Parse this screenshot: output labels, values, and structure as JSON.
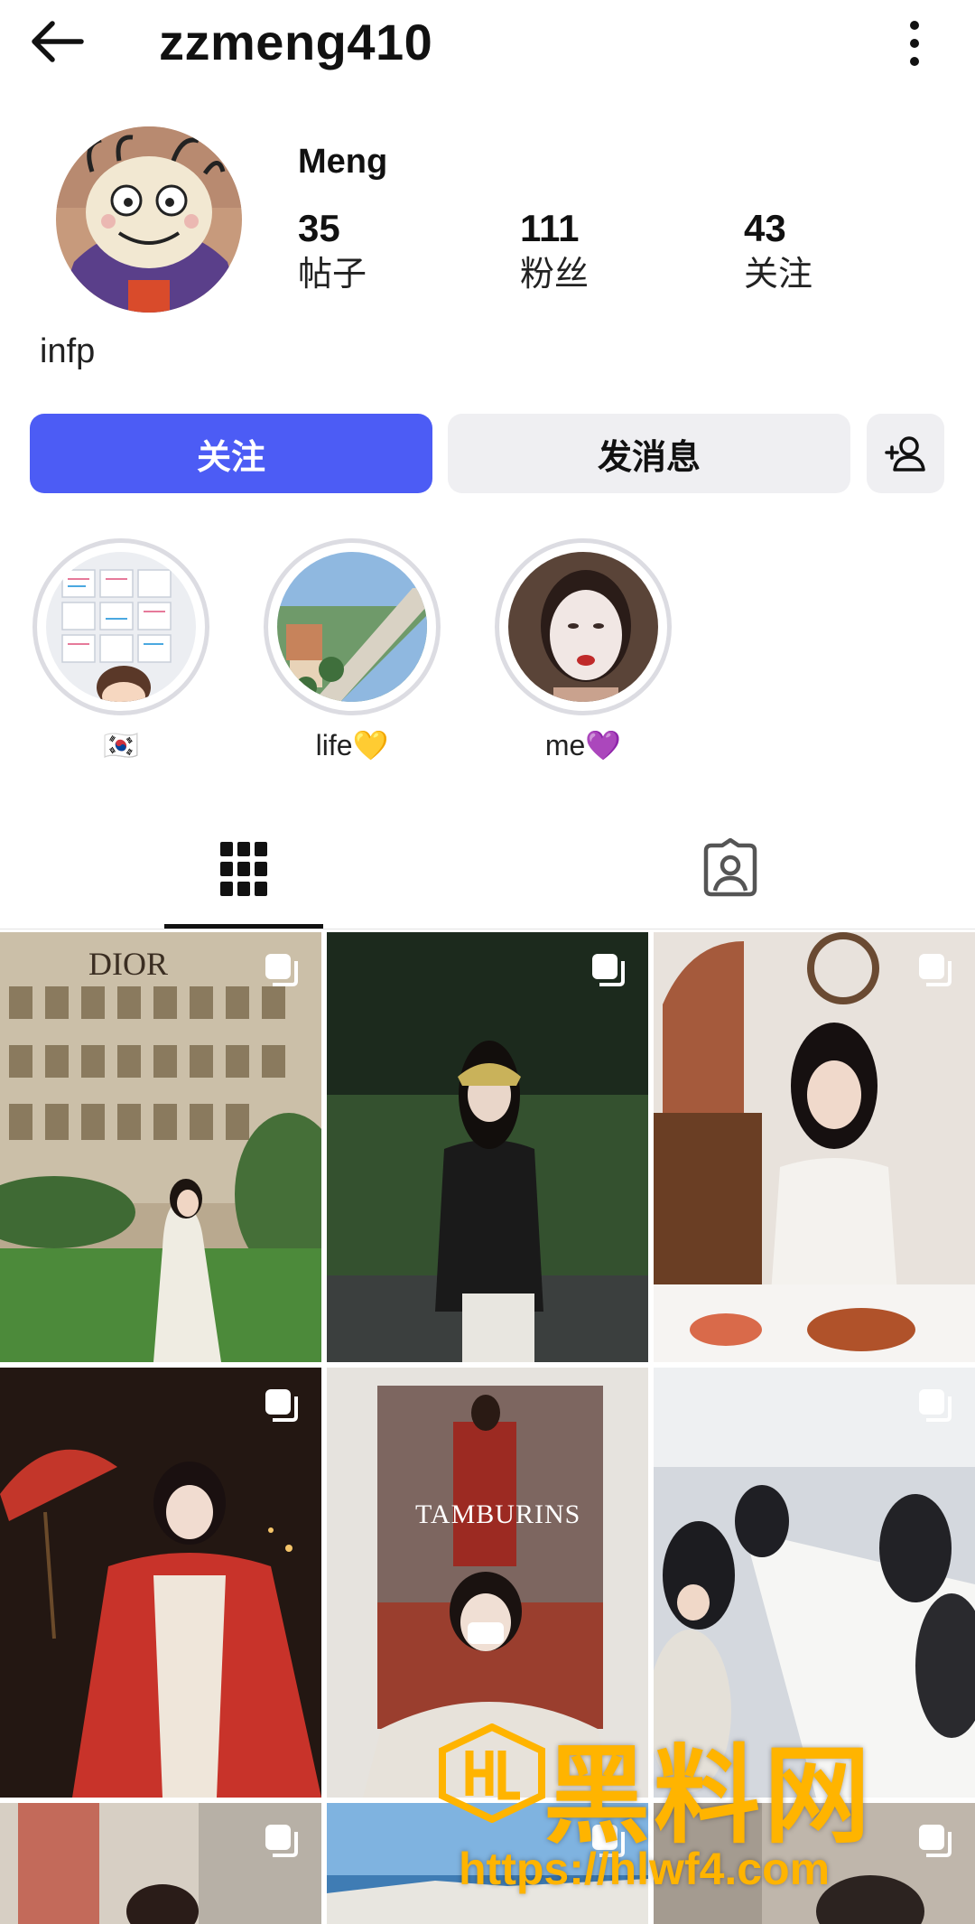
{
  "header": {
    "username": "zzmeng410",
    "back_icon": "back-arrow-icon",
    "more_icon": "more-vertical-icon"
  },
  "profile": {
    "display_name": "Meng",
    "bio": "infp",
    "stats": [
      {
        "count": "35",
        "label": "帖子"
      },
      {
        "count": "111",
        "label": "粉丝"
      },
      {
        "count": "43",
        "label": "关注"
      }
    ]
  },
  "actions": {
    "follow_label": "关注",
    "message_label": "发消息",
    "add_person_icon": "add-person-icon",
    "accent_color": "#4c5cf5"
  },
  "highlights": [
    {
      "label": "🇰🇷"
    },
    {
      "label": "life💛"
    },
    {
      "label": "me💜"
    }
  ],
  "tabs": [
    {
      "icon": "grid-icon",
      "active": true
    },
    {
      "icon": "tagged-user-icon",
      "active": false
    }
  ],
  "posts": [
    {
      "text": "DIOR",
      "multi": true
    },
    {
      "text": "",
      "multi": true
    },
    {
      "text": "",
      "multi": true
    },
    {
      "text": "",
      "multi": true
    },
    {
      "text": "TAMBURINS",
      "multi": false
    },
    {
      "text": "",
      "multi": true
    },
    {
      "text": "",
      "multi": true
    },
    {
      "text": "",
      "multi": true
    },
    {
      "text": "",
      "multi": true
    }
  ],
  "watermark": {
    "title": "黑料网",
    "url": "https://hlwf4.com"
  }
}
